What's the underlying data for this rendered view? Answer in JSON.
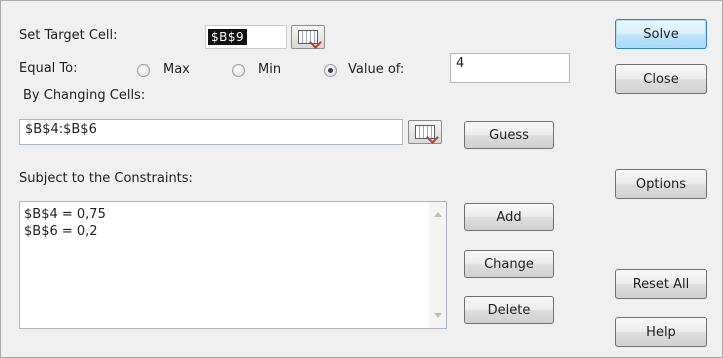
{
  "target": {
    "label": "Set Target Cell:",
    "value": "$B$9"
  },
  "equal_to": {
    "label": "Equal To:",
    "options": [
      {
        "label": "Max",
        "selected": false
      },
      {
        "label": "Min",
        "selected": false
      },
      {
        "label": "Value of:",
        "selected": true
      }
    ],
    "value": "4"
  },
  "changing": {
    "label": "By Changing Cells:",
    "value": "$B$4:$B$6"
  },
  "constraints": {
    "label": "Subject to the Constraints:",
    "items": [
      "$B$4 = 0,75",
      "$B$6 = 0,2"
    ]
  },
  "buttons": {
    "solve": "Solve",
    "close": "Close",
    "guess": "Guess",
    "options": "Options",
    "add": "Add",
    "change": "Change",
    "delete": "Delete",
    "reset_all": "Reset All",
    "help": "Help"
  },
  "icons": {
    "ref": "collapse-dialog-icon",
    "radio": "radio-icon",
    "scroll_up": "scroll-up-icon",
    "scroll_down": "scroll-down-icon"
  },
  "colors": {
    "dialog_bg": "#f0f0f0",
    "default_button": "#bee6fd",
    "selection": "#111111"
  }
}
